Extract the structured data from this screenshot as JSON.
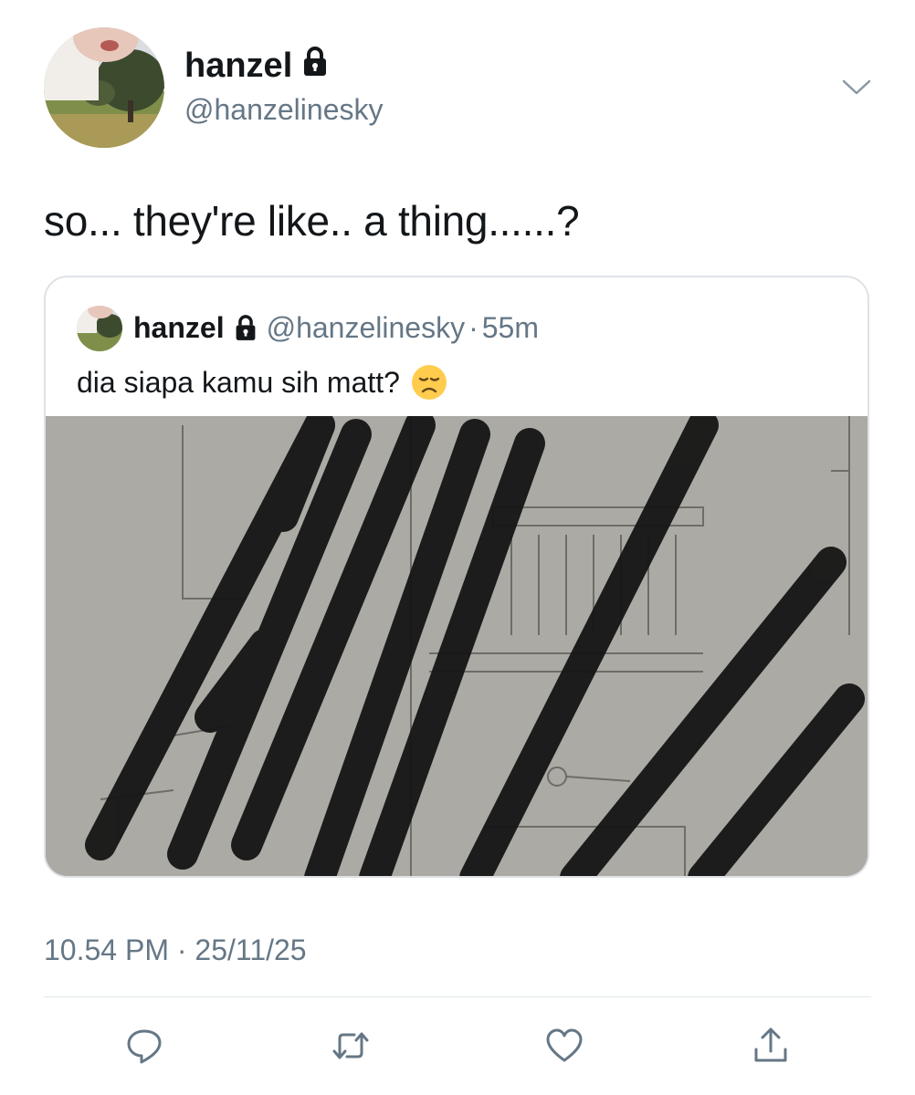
{
  "tweet": {
    "author": {
      "display_name": "hanzel",
      "handle": "@hanzelinesky",
      "locked_icon": "lock-icon"
    },
    "text": "so... they're like.. a thing......?",
    "timestamp": "10.54 PM",
    "date": "25/11/25",
    "separator": "·"
  },
  "quoted_tweet": {
    "display_name": "hanzel",
    "handle": "@hanzelinesky",
    "separator": "·",
    "time_ago": "55m",
    "text": "dia siapa kamu sih matt?",
    "emoji": "disappointed-face-emoji",
    "media": "scribbled-sketch-image"
  },
  "actions": [
    {
      "name": "reply",
      "icon": "reply-icon"
    },
    {
      "name": "retweet",
      "icon": "retweet-icon"
    },
    {
      "name": "like",
      "icon": "heart-icon"
    },
    {
      "name": "share",
      "icon": "share-icon"
    }
  ],
  "colors": {
    "text": "#14171a",
    "secondary": "#657786",
    "border": "#dde2e6",
    "divider": "#e1e8ed"
  }
}
